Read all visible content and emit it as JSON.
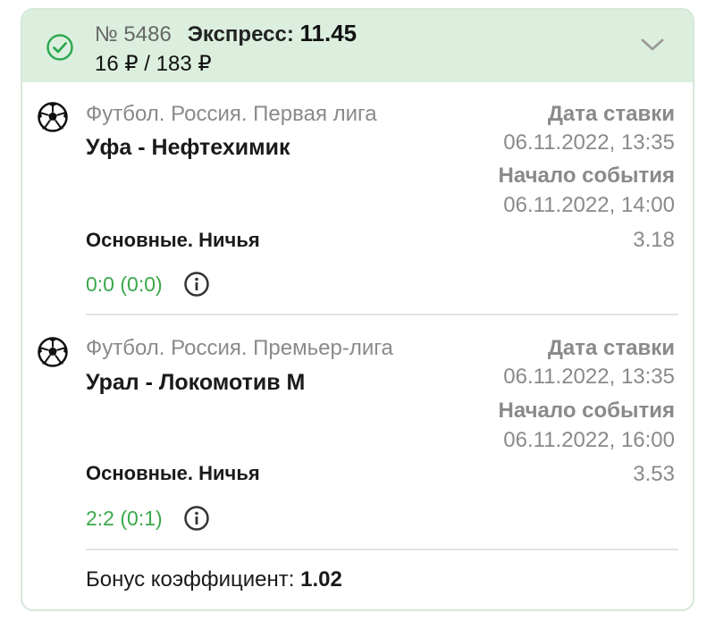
{
  "bet": {
    "number": "№ 5486",
    "type_label": "Экспресс:",
    "total_odds": "11.45",
    "stake_payout": "16 ₽ / 183 ₽",
    "status_icon": "check-circle-icon",
    "expand_icon": "chevron-down-icon"
  },
  "events": [
    {
      "sport_icon": "soccer-ball-icon",
      "league": "Футбол. Россия. Первая лига",
      "teams": "Уфа - Нефтехимик",
      "bet_date_label": "Дата ставки",
      "bet_date": "06.11.2022, 13:35",
      "start_label": "Начало события",
      "start_date": "06.11.2022, 14:00",
      "market": "Основные. Ничья",
      "odds": "3.18",
      "score": "0:0 (0:0)"
    },
    {
      "sport_icon": "soccer-ball-icon",
      "league": "Футбол. Россия. Премьер-лига",
      "teams": "Урал - Локомотив М",
      "bet_date_label": "Дата ставки",
      "bet_date": "06.11.2022, 13:35",
      "start_label": "Начало события",
      "start_date": "06.11.2022, 16:00",
      "market": "Основные. Ничья",
      "odds": "3.53",
      "score": "2:2 (0:1)"
    }
  ],
  "bonus": {
    "label": "Бонус коэффициент:",
    "value": "1.02"
  },
  "colors": {
    "header_bg": "#dcefdf",
    "success_green": "#3aa84a",
    "muted_text": "#8a8a8a"
  }
}
